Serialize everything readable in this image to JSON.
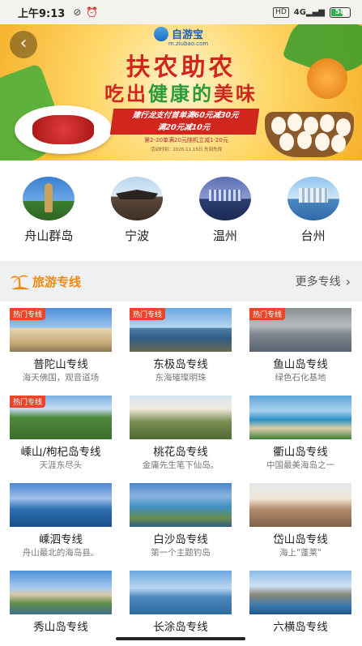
{
  "status_bar": {
    "time": "上午9:13",
    "left_icons": [
      "mute-icon",
      "alarm-icon"
    ],
    "network": "HD",
    "signal": "4G",
    "battery": "58"
  },
  "banner": {
    "logo_name": "自游宝",
    "logo_sub": "m.ziubao.com",
    "title": "扶农助农",
    "subtitle_pre": "吃出",
    "subtitle_highlight": "健康的",
    "subtitle_post": "美味",
    "promo_line1": "建行龙支付首单满60元减30元",
    "promo_line2": "满20元减10元",
    "promo_line3": "第2-20单满20元随机立减1-20元",
    "promo_line4": "活动时间：2020.11.15日 先到先得"
  },
  "cities": [
    {
      "label": "舟山群岛",
      "icon": "putuo-statue"
    },
    {
      "label": "宁波",
      "icon": "temple-roof"
    },
    {
      "label": "温州",
      "icon": "city-skyline"
    },
    {
      "label": "台州",
      "icon": "city-waterfront"
    }
  ],
  "section": {
    "title": "旅游专线",
    "more_label": "更多专线"
  },
  "routes": [
    {
      "name": "普陀山专线",
      "desc": "海天佛国，观音道场",
      "tag": "热门专线"
    },
    {
      "name": "东极岛专线",
      "desc": "东海璀璨明珠",
      "tag": "热门专线"
    },
    {
      "name": "鱼山岛专线",
      "desc": "绿色石化基地",
      "tag": "热门专线"
    },
    {
      "name": "嵊山/枸杞岛专线",
      "desc": "天涯东尽头",
      "tag": "热门专线"
    },
    {
      "name": "桃花岛专线",
      "desc": "金庸先生笔下仙岛。",
      "tag": ""
    },
    {
      "name": "衢山岛专线",
      "desc": "中国最美海岛之一",
      "tag": ""
    },
    {
      "name": "嵊泗专线",
      "desc": "舟山最北的海岛县。",
      "tag": ""
    },
    {
      "name": "白沙岛专线",
      "desc": "第一个主题钓岛",
      "tag": ""
    },
    {
      "name": "岱山岛专线",
      "desc": "海上\"蓬莱\"",
      "tag": ""
    },
    {
      "name": "秀山岛专线",
      "desc": "",
      "tag": ""
    },
    {
      "name": "长涂岛专线",
      "desc": "",
      "tag": ""
    },
    {
      "name": "六横岛专线",
      "desc": "",
      "tag": ""
    }
  ],
  "colors": {
    "accent": "#f08a10",
    "hot_tag": "#e8452b",
    "banner_red": "#d0261e",
    "section_bg": "#eef0f2"
  }
}
